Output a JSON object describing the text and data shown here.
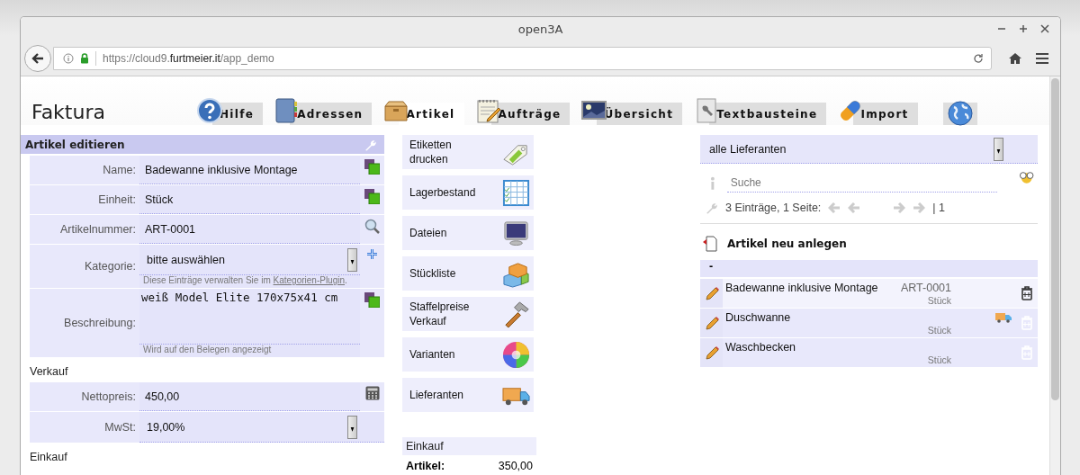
{
  "window": {
    "title": "open3A"
  },
  "address_bar": {
    "host": "https://cloud9.",
    "domain": "furtmeier.it",
    "path": "/app_demo"
  },
  "app_title": "Faktura",
  "tabs": [
    {
      "label": "Hilfe",
      "selected": false
    },
    {
      "label": "Adressen",
      "selected": false
    },
    {
      "label": "Artikel",
      "selected": true
    },
    {
      "label": "Aufträge",
      "selected": false
    },
    {
      "label": "Übersicht",
      "selected": false
    },
    {
      "label": "Textbausteine",
      "selected": false
    },
    {
      "label": "Import",
      "selected": false
    },
    {
      "selected": false
    }
  ],
  "editor": {
    "title": "Artikel editieren",
    "rows": [
      {
        "kind": "text",
        "label": "Name:",
        "value": "Badewanne inklusive Montage"
      },
      {
        "kind": "text",
        "label": "Einheit:",
        "value": "Stück"
      },
      {
        "kind": "text",
        "label": "Artikelnummer:",
        "value": "ART-0001"
      },
      {
        "kind": "select",
        "label": "Kategorie:",
        "value": "bitte auswählen",
        "hint": "Diese Einträge verwalten Sie im ",
        "hint_link": "Kategorien-Plugin",
        "hint_end": "."
      },
      {
        "kind": "textarea",
        "label": "Beschreibung:",
        "value": "weiß Model Elite 170x75x41 cm",
        "hint": "Wird auf den Belegen angezeigt"
      },
      {
        "kind": "heading",
        "label": "Verkauf"
      },
      {
        "kind": "text",
        "label": "Nettopreis:",
        "value": "450,00"
      },
      {
        "kind": "select",
        "label": "MwSt:",
        "value": "19,00%"
      },
      {
        "kind": "heading",
        "label": "Einkauf"
      }
    ]
  },
  "actions": [
    {
      "label": "Etiketten drucken"
    },
    {
      "label": "Lagerbestand"
    },
    {
      "label": "Dateien"
    },
    {
      "label": "Stückliste"
    },
    {
      "label": "Staffelpreise Verkauf"
    },
    {
      "label": "Varianten"
    },
    {
      "label": "Lieferanten"
    }
  ],
  "purchase": {
    "title": "Einkauf",
    "label": "Artikel:",
    "value": "350,00"
  },
  "article_list": {
    "filter": "alle Lieferanten",
    "search_placeholder": "Suche",
    "count": "3 Einträge, 1 Seite:",
    "page": "| 1",
    "new_label": "Artikel neu anlegen",
    "group": "-",
    "rows": [
      {
        "name": "Badewanne inklusive Montage",
        "number": "ART-0001",
        "unit": "Stück",
        "supplier": false,
        "selected": true
      },
      {
        "name": "Duschwanne",
        "unit": "Stück",
        "supplier": true,
        "selected": false
      },
      {
        "name": "Waschbecken",
        "unit": "Stück",
        "supplier": false,
        "selected": false
      }
    ]
  }
}
